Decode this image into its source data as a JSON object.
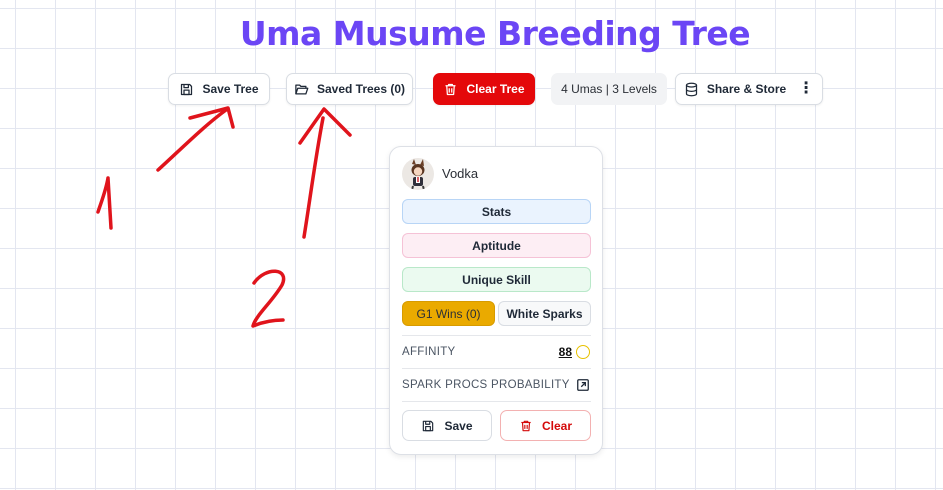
{
  "page": {
    "title": "Uma Musume Breeding Tree"
  },
  "toolbar": {
    "save_label": "Save Tree",
    "saved_label": "Saved Trees (0)",
    "clear_label": "Clear Tree",
    "count_label": "4 Umas | 3 Levels",
    "share_label": "Share & Store",
    "more_glyph": "⋮"
  },
  "card": {
    "name": "Vodka",
    "stats_label": "Stats",
    "aptitude_label": "Aptitude",
    "unique_skill_label": "Unique Skill",
    "g1_wins_label": "G1 Wins (0)",
    "white_sparks_label": "White Sparks",
    "affinity_label": "AFFINITY",
    "affinity_value": "88",
    "spark_procs_label": "SPARK PROCS PROBABILITY",
    "save_label": "Save",
    "clear_label": "Clear"
  },
  "annotations": {
    "label_1": "1",
    "label_2": "2",
    "color": "#e0141c"
  },
  "colors": {
    "title": "#6b46f5",
    "clear_button": "#e4080a",
    "g1_badge": "#eaaa00"
  }
}
